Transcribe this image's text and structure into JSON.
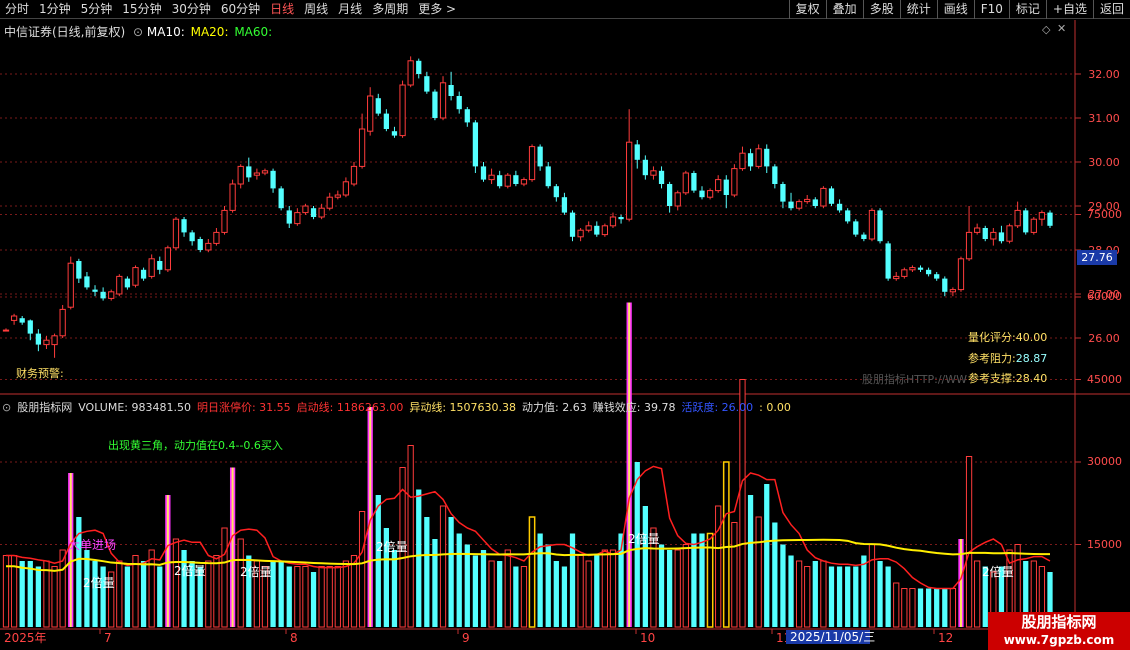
{
  "toolbar": {
    "periods": [
      {
        "label": "分时",
        "active": false
      },
      {
        "label": "1分钟",
        "active": false
      },
      {
        "label": "5分钟",
        "active": false
      },
      {
        "label": "15分钟",
        "active": false
      },
      {
        "label": "30分钟",
        "active": false
      },
      {
        "label": "60分钟",
        "active": false
      },
      {
        "label": "日线",
        "active": true
      },
      {
        "label": "周线",
        "active": false
      },
      {
        "label": "月线",
        "active": false
      },
      {
        "label": "多周期",
        "active": false
      },
      {
        "label": "更多 >",
        "active": false
      }
    ],
    "tools": [
      "复权",
      "叠加",
      "多股",
      "统计",
      "画线",
      "F10",
      "标记",
      "+自选",
      "返回"
    ]
  },
  "stock": {
    "title": "中信证券(日线,前复权)",
    "ma10": "MA10:",
    "ma20": "MA20:",
    "ma60": "MA60:",
    "current_price_tag": "27.76"
  },
  "price_axis": [
    "32.00",
    "31.00",
    "30.00",
    "29.00",
    "28.00",
    "27.00",
    "26.00"
  ],
  "stats": {
    "score_label": "量化评分:",
    "score_value": "40.00",
    "resist_label": "参考阻力:",
    "resist_value": "28.87",
    "support_label": "参考支撑:",
    "support_value": "28.40",
    "finance_warning": "财务预警:",
    "watermark_text": "股朋指标HTTP://WW"
  },
  "volume_header": {
    "indicator_name": "股朋指标网",
    "volume": "VOLUME: 983481.50",
    "limit_up": "明日涨停价: 31.55",
    "start_line": "启动线: 1186263.00",
    "move_line": "异动线: 1507630.38",
    "power": "动力值: 2.63",
    "profit": "赚钱效应: 39.78",
    "active": "活跃度: 26.00",
    "tail": ": 0.00"
  },
  "volume_axis": [
    "75000",
    "60000",
    "45000",
    "30000",
    "15000"
  ],
  "volume_notes": {
    "tip": "出现黄三角，动力值在0.4--0.6买入",
    "big_order": "大单进场",
    "double_vol": "2倍量"
  },
  "date_axis": {
    "year": "2025年",
    "months": [
      "7",
      "8",
      "9",
      "10",
      "11",
      "12"
    ],
    "cursor_date": "2025/11/05/三"
  },
  "site_badge": {
    "name": "股朋指标网",
    "url": "www.7gpzb.com"
  },
  "chart_data": {
    "type": "candlestick",
    "price_ticks": [
      32,
      31,
      30,
      29,
      28,
      27,
      26
    ],
    "candles": [
      [
        26.18,
        26.18,
        26.15,
        26.22
      ],
      [
        26.4,
        26.5,
        26.3,
        26.55
      ],
      [
        26.45,
        26.35,
        26.3,
        26.5
      ],
      [
        26.4,
        26.1,
        25.95,
        26.42
      ],
      [
        26.1,
        25.85,
        25.7,
        26.2
      ],
      [
        25.85,
        25.95,
        25.75,
        26.05
      ],
      [
        25.85,
        26.05,
        25.55,
        26.1
      ],
      [
        26.05,
        26.65,
        26.0,
        26.75
      ],
      [
        26.7,
        27.7,
        26.65,
        27.85
      ],
      [
        27.75,
        27.35,
        27.25,
        27.8
      ],
      [
        27.4,
        27.15,
        27.1,
        27.5
      ],
      [
        27.1,
        27.05,
        26.95,
        27.2
      ],
      [
        27.05,
        26.9,
        26.85,
        27.15
      ],
      [
        26.9,
        27.05,
        26.85,
        27.1
      ],
      [
        27.0,
        27.4,
        26.95,
        27.45
      ],
      [
        27.35,
        27.15,
        27.1,
        27.4
      ],
      [
        27.2,
        27.6,
        27.15,
        27.65
      ],
      [
        27.55,
        27.35,
        27.3,
        27.6
      ],
      [
        27.4,
        27.8,
        27.35,
        27.9
      ],
      [
        27.75,
        27.55,
        27.45,
        27.85
      ],
      [
        27.55,
        28.05,
        27.5,
        28.1
      ],
      [
        28.05,
        28.7,
        28.0,
        28.75
      ],
      [
        28.7,
        28.4,
        28.3,
        28.75
      ],
      [
        28.4,
        28.2,
        28.1,
        28.45
      ],
      [
        28.25,
        28.0,
        27.95,
        28.3
      ],
      [
        28.0,
        28.15,
        27.95,
        28.25
      ],
      [
        28.15,
        28.4,
        28.1,
        28.5
      ],
      [
        28.4,
        28.9,
        28.35,
        29.0
      ],
      [
        28.9,
        29.5,
        28.85,
        29.6
      ],
      [
        29.5,
        29.9,
        29.4,
        29.95
      ],
      [
        29.9,
        29.65,
        29.55,
        30.1
      ],
      [
        29.7,
        29.75,
        29.6,
        29.85
      ],
      [
        29.75,
        29.8,
        29.7,
        29.85
      ],
      [
        29.8,
        29.4,
        29.3,
        29.85
      ],
      [
        29.4,
        28.95,
        28.9,
        29.45
      ],
      [
        28.9,
        28.6,
        28.5,
        29.0
      ],
      [
        28.6,
        28.85,
        28.55,
        28.95
      ],
      [
        28.85,
        29.0,
        28.8,
        29.05
      ],
      [
        28.95,
        28.75,
        28.7,
        29.0
      ],
      [
        28.75,
        28.95,
        28.7,
        29.05
      ],
      [
        28.95,
        29.2,
        28.9,
        29.3
      ],
      [
        29.2,
        29.25,
        29.15,
        29.35
      ],
      [
        29.25,
        29.55,
        29.2,
        29.65
      ],
      [
        29.5,
        29.9,
        29.45,
        30.0
      ],
      [
        29.9,
        30.75,
        29.85,
        31.1
      ],
      [
        30.7,
        31.5,
        30.6,
        31.7
      ],
      [
        31.45,
        31.1,
        31.05,
        31.55
      ],
      [
        31.1,
        30.75,
        30.7,
        31.2
      ],
      [
        30.7,
        30.6,
        30.55,
        30.8
      ],
      [
        30.6,
        31.75,
        30.55,
        31.85
      ],
      [
        31.75,
        32.3,
        31.7,
        32.4
      ],
      [
        32.3,
        32.0,
        31.9,
        32.35
      ],
      [
        31.95,
        31.6,
        31.55,
        32.05
      ],
      [
        31.6,
        31.0,
        30.95,
        31.65
      ],
      [
        31.0,
        31.8,
        30.95,
        31.95
      ],
      [
        31.75,
        31.5,
        31.4,
        32.05
      ],
      [
        31.5,
        31.2,
        31.1,
        31.6
      ],
      [
        31.2,
        30.9,
        30.8,
        31.25
      ],
      [
        30.9,
        29.9,
        29.75,
        30.95
      ],
      [
        29.9,
        29.6,
        29.55,
        30.0
      ],
      [
        29.6,
        29.7,
        29.5,
        29.85
      ],
      [
        29.7,
        29.45,
        29.4,
        29.8
      ],
      [
        29.45,
        29.7,
        29.4,
        29.75
      ],
      [
        29.7,
        29.5,
        29.45,
        29.8
      ],
      [
        29.5,
        29.6,
        29.45,
        29.65
      ],
      [
        29.6,
        30.35,
        29.55,
        30.4
      ],
      [
        30.35,
        29.9,
        29.8,
        30.4
      ],
      [
        29.9,
        29.45,
        29.4,
        30.0
      ],
      [
        29.45,
        29.2,
        29.1,
        29.5
      ],
      [
        29.2,
        28.85,
        28.8,
        29.3
      ],
      [
        28.85,
        28.3,
        28.2,
        28.9
      ],
      [
        28.3,
        28.45,
        28.2,
        28.5
      ],
      [
        28.45,
        28.55,
        28.4,
        28.65
      ],
      [
        28.55,
        28.35,
        28.3,
        28.65
      ],
      [
        28.35,
        28.55,
        28.3,
        28.6
      ],
      [
        28.55,
        28.75,
        28.5,
        28.85
      ],
      [
        28.75,
        28.7,
        28.6,
        28.8
      ],
      [
        28.7,
        30.45,
        28.65,
        31.2
      ],
      [
        30.4,
        30.05,
        29.85,
        30.5
      ],
      [
        30.05,
        29.7,
        29.6,
        30.15
      ],
      [
        29.7,
        29.8,
        29.6,
        29.9
      ],
      [
        29.8,
        29.5,
        29.4,
        29.9
      ],
      [
        29.5,
        29.0,
        28.85,
        29.55
      ],
      [
        29.0,
        29.3,
        28.9,
        29.35
      ],
      [
        29.3,
        29.75,
        29.25,
        29.8
      ],
      [
        29.75,
        29.35,
        29.3,
        29.8
      ],
      [
        29.35,
        29.2,
        29.15,
        29.45
      ],
      [
        29.2,
        29.35,
        29.15,
        29.4
      ],
      [
        29.35,
        29.6,
        29.3,
        29.7
      ],
      [
        29.6,
        29.25,
        28.95,
        29.7
      ],
      [
        29.25,
        29.85,
        29.2,
        29.95
      ],
      [
        29.85,
        30.2,
        29.8,
        30.35
      ],
      [
        30.2,
        29.9,
        29.8,
        30.3
      ],
      [
        29.9,
        30.3,
        29.85,
        30.4
      ],
      [
        30.3,
        29.9,
        29.75,
        30.4
      ],
      [
        29.9,
        29.5,
        29.4,
        29.95
      ],
      [
        29.5,
        29.1,
        28.95,
        29.55
      ],
      [
        29.1,
        28.95,
        28.9,
        29.3
      ],
      [
        28.95,
        29.1,
        28.9,
        29.15
      ],
      [
        29.1,
        29.15,
        29.05,
        29.25
      ],
      [
        29.15,
        29.0,
        28.95,
        29.2
      ],
      [
        29.0,
        29.4,
        28.95,
        29.45
      ],
      [
        29.4,
        29.05,
        29.0,
        29.45
      ],
      [
        29.05,
        28.9,
        28.85,
        29.15
      ],
      [
        28.9,
        28.65,
        28.6,
        28.95
      ],
      [
        28.65,
        28.35,
        28.3,
        28.7
      ],
      [
        28.35,
        28.25,
        28.2,
        28.4
      ],
      [
        28.25,
        28.9,
        28.2,
        28.95
      ],
      [
        28.9,
        28.2,
        28.15,
        28.95
      ],
      [
        28.15,
        27.35,
        27.3,
        28.2
      ],
      [
        27.35,
        27.4,
        27.3,
        27.5
      ],
      [
        27.4,
        27.55,
        27.35,
        27.6
      ],
      [
        27.55,
        27.6,
        27.5,
        27.65
      ],
      [
        27.6,
        27.55,
        27.5,
        27.65
      ],
      [
        27.55,
        27.45,
        27.4,
        27.6
      ],
      [
        27.45,
        27.35,
        27.3,
        27.5
      ],
      [
        27.35,
        27.05,
        26.95,
        27.4
      ],
      [
        27.05,
        27.1,
        26.95,
        27.15
      ],
      [
        27.1,
        27.8,
        27.05,
        27.85
      ],
      [
        27.8,
        28.4,
        27.75,
        29.0
      ],
      [
        28.4,
        28.5,
        28.35,
        28.6
      ],
      [
        28.5,
        28.25,
        28.2,
        28.55
      ],
      [
        28.25,
        28.4,
        28.1,
        28.5
      ],
      [
        28.4,
        28.2,
        28.15,
        28.55
      ],
      [
        28.2,
        28.55,
        28.15,
        28.6
      ],
      [
        28.55,
        28.9,
        28.5,
        29.1
      ],
      [
        28.9,
        28.4,
        28.35,
        28.95
      ],
      [
        28.4,
        28.7,
        28.35,
        28.75
      ],
      [
        28.7,
        28.85,
        28.55,
        28.9
      ],
      [
        28.85,
        28.55,
        28.5,
        28.9
      ]
    ],
    "volume_ticks": [
      75000,
      60000,
      45000,
      30000,
      15000
    ],
    "volume": [
      13000,
      13000,
      12000,
      12000,
      11000,
      12000,
      11000,
      14000,
      28000,
      20000,
      14000,
      12000,
      11000,
      10000,
      12000,
      11000,
      13000,
      12000,
      14000,
      11000,
      24000,
      16000,
      14000,
      12000,
      11000,
      12000,
      13000,
      18000,
      29000,
      16000,
      13000,
      12000,
      11000,
      12000,
      12000,
      11000,
      11000,
      11000,
      10000,
      11000,
      11000,
      11000,
      12000,
      13000,
      21000,
      40000,
      24000,
      18000,
      14000,
      29000,
      33000,
      25000,
      20000,
      16000,
      22000,
      20000,
      17000,
      15000,
      13000,
      14000,
      12000,
      12000,
      14000,
      11000,
      11000,
      20000,
      17000,
      15000,
      12000,
      11000,
      17000,
      13000,
      12000,
      13000,
      14000,
      14000,
      17000,
      59000,
      30000,
      22000,
      18000,
      15000,
      14000,
      14000,
      15000,
      17000,
      17000,
      17000,
      22000,
      30000,
      19000,
      45000,
      24000,
      20000,
      26000,
      19000,
      15000,
      13000,
      12000,
      11000,
      12000,
      12000,
      11000,
      11000,
      11000,
      11000,
      13000,
      15000,
      12000,
      11000,
      8000,
      7000,
      7000,
      7000,
      7000,
      7000,
      7000,
      7000,
      16000,
      31000,
      12000,
      11000,
      10000,
      11000,
      14000,
      15000,
      12000,
      12000,
      11000,
      10000
    ]
  }
}
